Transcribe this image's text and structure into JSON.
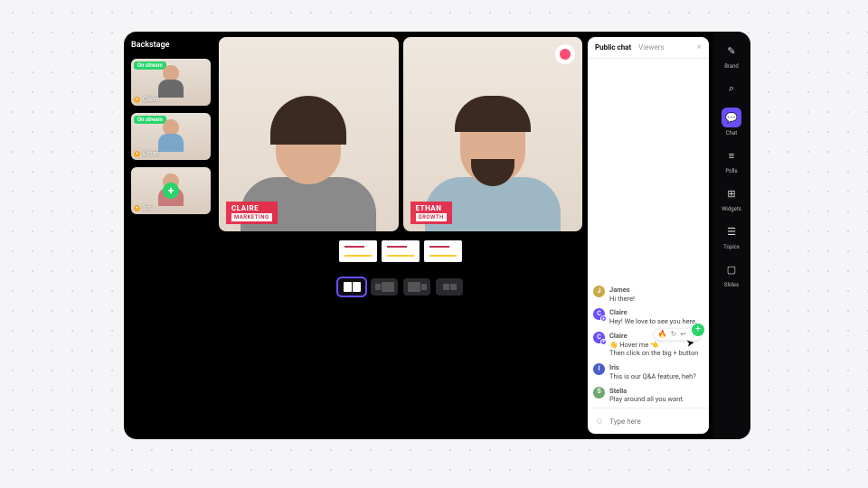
{
  "backstage": {
    "title": "Backstage",
    "on_stream_label": "On stream",
    "thumbs": [
      {
        "name": "Claire",
        "on_stream": true
      },
      {
        "name": "Ethan",
        "on_stream": true
      },
      {
        "name": "Iris",
        "on_stream": false,
        "add": true
      }
    ]
  },
  "stage": {
    "speakers": [
      {
        "name": "CLAIRE",
        "role": "MARKETING"
      },
      {
        "name": "ETHAN",
        "role": "GROWTH"
      }
    ]
  },
  "chat": {
    "tabs": {
      "public": "Public chat",
      "viewers": "Viewers"
    },
    "messages": [
      {
        "avatar": "J",
        "cls": "j",
        "who": "James",
        "text": "Hi there!"
      },
      {
        "avatar": "C",
        "cls": "c",
        "who": "Claire",
        "text": "Hey! We love to see you here.",
        "host": true
      },
      {
        "avatar": "C",
        "cls": "c",
        "who": "Claire",
        "text": "👋 Hover me 👈\nThen click on the big + button",
        "host": true,
        "react": true
      },
      {
        "avatar": "I",
        "cls": "i",
        "who": "Iris",
        "text": "This is our Q&A feature, heh?"
      },
      {
        "avatar": "S",
        "cls": "s",
        "who": "Stella",
        "text": "Play around all you want."
      }
    ],
    "input_placeholder": "Type here"
  },
  "rail": [
    {
      "icon": "✎",
      "label": "Brand",
      "name": "brand"
    },
    {
      "icon": "⌕",
      "label": "",
      "name": "search"
    },
    {
      "icon": "💬",
      "label": "Chat",
      "name": "chat",
      "active": true
    },
    {
      "icon": "≡",
      "label": "Polls",
      "name": "polls"
    },
    {
      "icon": "⊞",
      "label": "Widgets",
      "name": "widgets"
    },
    {
      "icon": "☰",
      "label": "Topics",
      "name": "topics"
    },
    {
      "icon": "▢",
      "label": "Slides",
      "name": "slides"
    }
  ]
}
